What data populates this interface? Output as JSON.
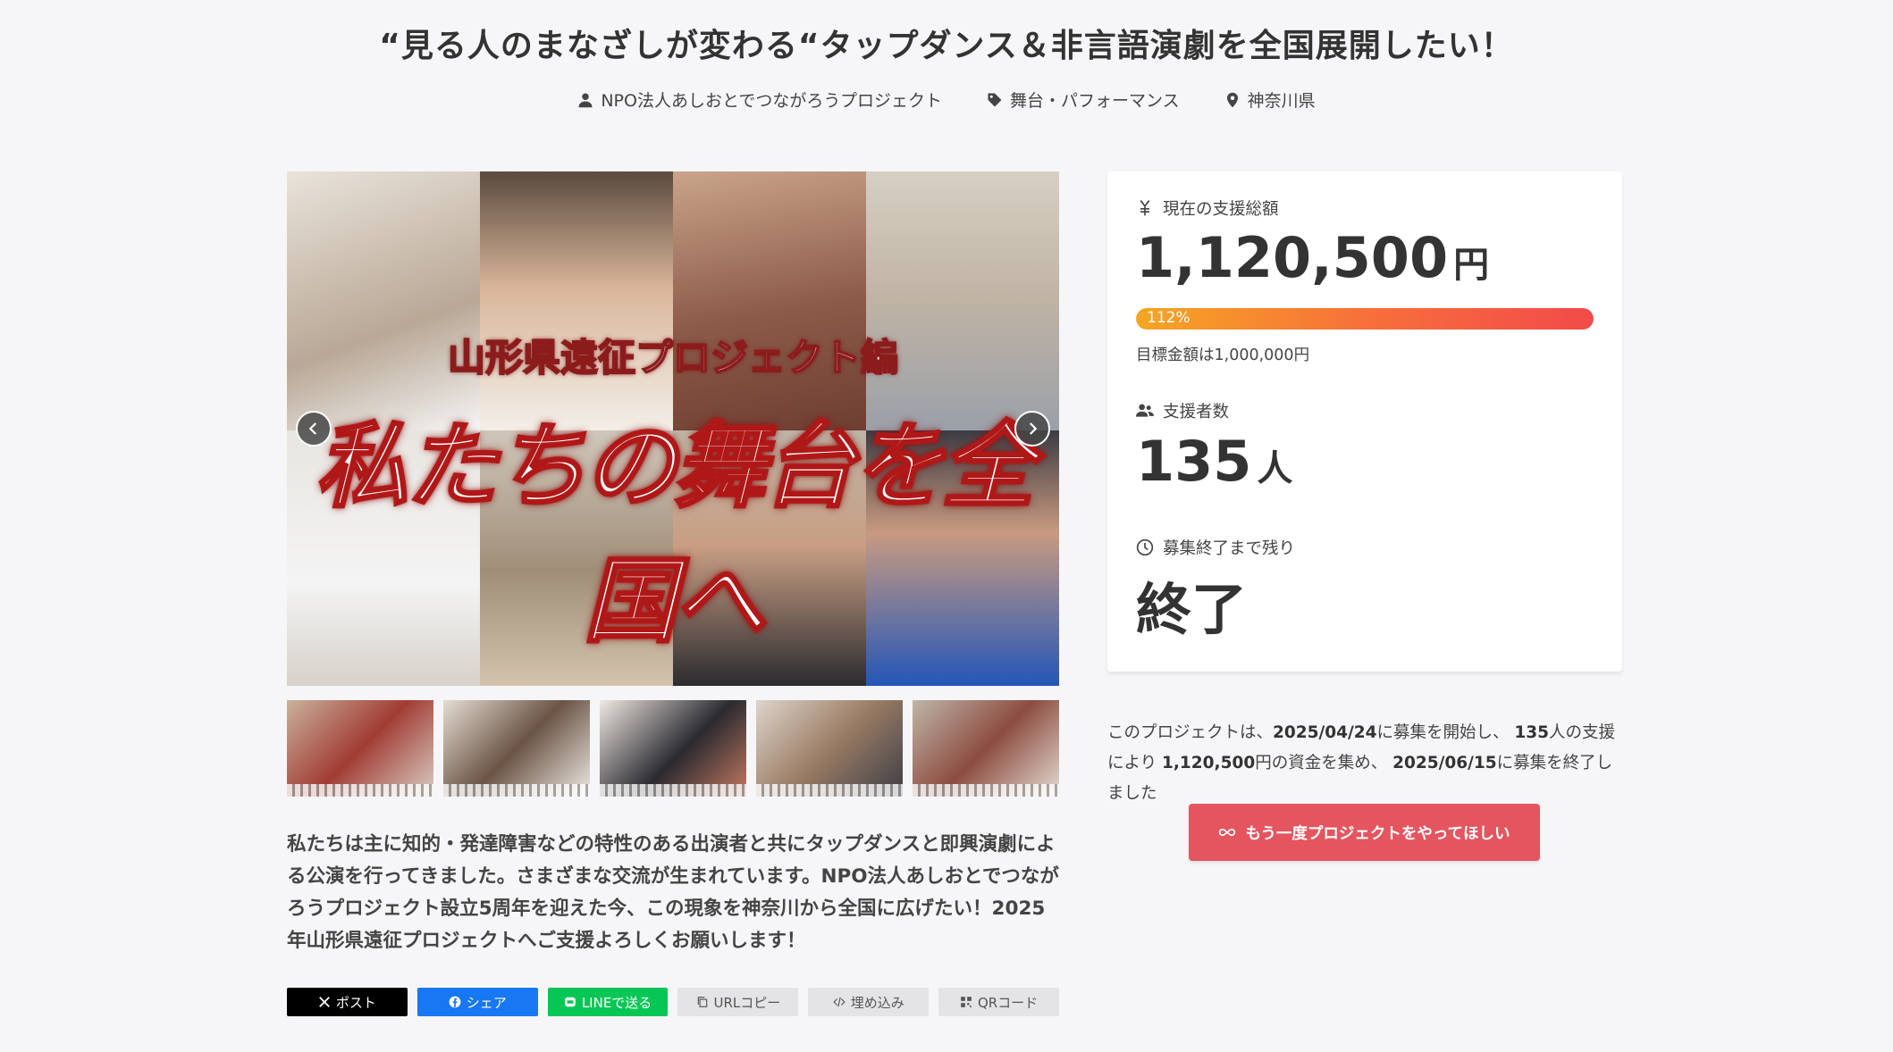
{
  "project": {
    "title": "“見る人のまなざしが変わる“タップダンス＆非言語演劇を全国展開したい！",
    "owner": "NPO法人あしおとでつながろうプロジェクト",
    "category": "舞台・パフォーマンス",
    "location": "神奈川県",
    "icons": [
      "user-icon",
      "tag-icon",
      "map-pin-icon"
    ]
  },
  "hero": {
    "subtitle": "山形県遠征プロジェクト編",
    "main_text": "私たちの舞台を全国へ",
    "prev_label": "previous",
    "next_label": "next",
    "thumbnail_count": 5
  },
  "description": "私たちは主に知的・発達障害などの特性のある出演者と共にタップダンスと即興演劇による公演を行ってきました。さまざまな交流が生まれています。NPO法人あしおとでつながろうプロジェクト設立5周年を迎えた今、この現象を神奈川から全国に広げたい！2025年山形県遠征プロジェクトへご支援よろしくお願いします！",
  "share": {
    "x": "ポスト",
    "facebook": "シェア",
    "line": "LINEで送る",
    "url_copy": "URLコピー",
    "embed": "埋め込み",
    "qr": "QRコード"
  },
  "stats": {
    "amount_label": "現在の支援総額",
    "amount": "1,120,500",
    "amount_unit": "円",
    "progress_text": "112%",
    "progress_percent": 112,
    "goal_text": "目標金額は1,000,000円",
    "supporters_label": "支援者数",
    "supporters": "135",
    "supporters_unit": "人",
    "remaining_label": "募集終了まで残り",
    "remaining": "終了"
  },
  "summary": {
    "t1": "このプロジェクトは、",
    "start_date": "2025/04/24",
    "t2": "に募集を開始し、",
    "supporters": "135",
    "t3": "人の支援により",
    "amount": "1,120,500",
    "t4": "円の資金を集め、",
    "end_date": "2025/06/15",
    "t5": "に募集を終了しました"
  },
  "cta": {
    "label": "もう一度プロジェクトをやってほしい",
    "icon": "infinity-icon"
  },
  "colors": {
    "cta": "#e5555f",
    "progress_start": "#f5a623",
    "progress_end": "#f24a4a",
    "facebook": "#1877f2",
    "line": "#06c755"
  }
}
